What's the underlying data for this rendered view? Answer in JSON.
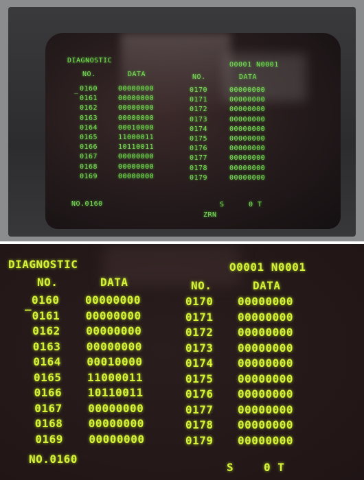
{
  "screen": {
    "title": "DIAGNOSTIC",
    "program": "O0001 N0001",
    "header_no": "NO.",
    "header_data": "DATA",
    "cursor": "_",
    "left_rows": [
      {
        "no": "0160",
        "data": "00000000"
      },
      {
        "no": "0161",
        "data": "00000000"
      },
      {
        "no": "0162",
        "data": "00000000"
      },
      {
        "no": "0163",
        "data": "00000000"
      },
      {
        "no": "0164",
        "data": "00010000"
      },
      {
        "no": "0165",
        "data": "11000011"
      },
      {
        "no": "0166",
        "data": "10110011"
      },
      {
        "no": "0167",
        "data": "00000000"
      },
      {
        "no": "0168",
        "data": "00000000"
      },
      {
        "no": "0169",
        "data": "00000000"
      }
    ],
    "right_rows": [
      {
        "no": "0170",
        "data": "00000000"
      },
      {
        "no": "0171",
        "data": "00000000"
      },
      {
        "no": "0172",
        "data": "00000000"
      },
      {
        "no": "0173",
        "data": "00000000"
      },
      {
        "no": "0174",
        "data": "00000000"
      },
      {
        "no": "0175",
        "data": "00000000"
      },
      {
        "no": "0176",
        "data": "00000000"
      },
      {
        "no": "0177",
        "data": "00000000"
      },
      {
        "no": "0178",
        "data": "00000000"
      },
      {
        "no": "0179",
        "data": "00000000"
      }
    ],
    "input_line": "NO.0160",
    "status_s": "S",
    "status_t": "0 T",
    "mode": "ZRN"
  },
  "colors": {
    "phosphor_top": "#7fe05a",
    "phosphor_bottom": "#d7f238",
    "crt_background": "#2a1d1d",
    "bezel": "#2c2c2e"
  }
}
